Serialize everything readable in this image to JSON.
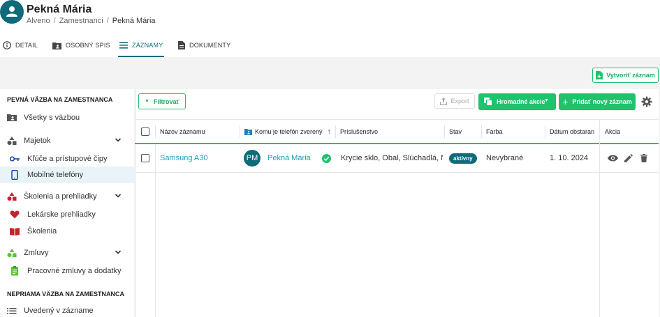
{
  "header": {
    "title": "Pekná Mária",
    "breadcrumb": [
      "Alveno",
      "Zamestnanci",
      "Pekná Mária"
    ],
    "avatar_icon": "person-icon"
  },
  "tabs": [
    {
      "label": "DETAIL",
      "icon": "info-icon",
      "active": false
    },
    {
      "label": "OSOBNÝ SPIS",
      "icon": "folder-person-icon",
      "active": false
    },
    {
      "label": "ZÁZNAMY",
      "icon": "list-icon",
      "active": true
    },
    {
      "label": "DOKUMENTY",
      "icon": "document-icon",
      "active": false
    }
  ],
  "create_button": "Vytvoriť záznam",
  "sidebar": {
    "section1": "PEVNÁ VÄZBA NA ZAMESTNANCA",
    "section2": "NEPRIAMA VÄZBA NA ZAMESTNANCA",
    "items": [
      {
        "label": "Všetky s väzbou",
        "icon": "folder-person-icon"
      },
      {
        "label": "Majetok",
        "icon": "shapes-icon"
      },
      {
        "label": "Kľúče a prístupové čipy",
        "icon": "key-icon"
      },
      {
        "label": "Mobilné telefóny",
        "icon": "phone-icon"
      },
      {
        "label": "Školenia a prehliadky",
        "icon": "shapes-icon"
      },
      {
        "label": "Lekárske prehliadky",
        "icon": "heart-icon"
      },
      {
        "label": "Školenia",
        "icon": "book-icon"
      },
      {
        "label": "Zmluvy",
        "icon": "shapes-icon"
      },
      {
        "label": "Pracovné zmluvy a dodatky",
        "icon": "contract-icon"
      },
      {
        "label": "Uvedený v zázname",
        "icon": "list-icon"
      }
    ]
  },
  "toolbar": {
    "filter": "Filtrovať",
    "export": "Export",
    "bulk": "Hromadné akcie",
    "add": "Pridať nový záznam"
  },
  "table": {
    "columns": [
      "Názov záznamu",
      "Komu je telefón zverený",
      "Príslušenstvo",
      "Stav",
      "Farba",
      "Dátum obstaran",
      "Akcia"
    ],
    "rows": [
      {
        "name": "Samsung A30",
        "initials": "PM",
        "person": "Pekná Mária",
        "accessories": "Krycie sklo, Obal, Slúchadlá, Na...",
        "status": "aktívny",
        "color": "Nevybrané",
        "date": "1. 10. 2024"
      }
    ]
  },
  "colors": {
    "accent": "#1ec36b",
    "primary": "#0f6b7a",
    "link": "#1a9fb8"
  }
}
